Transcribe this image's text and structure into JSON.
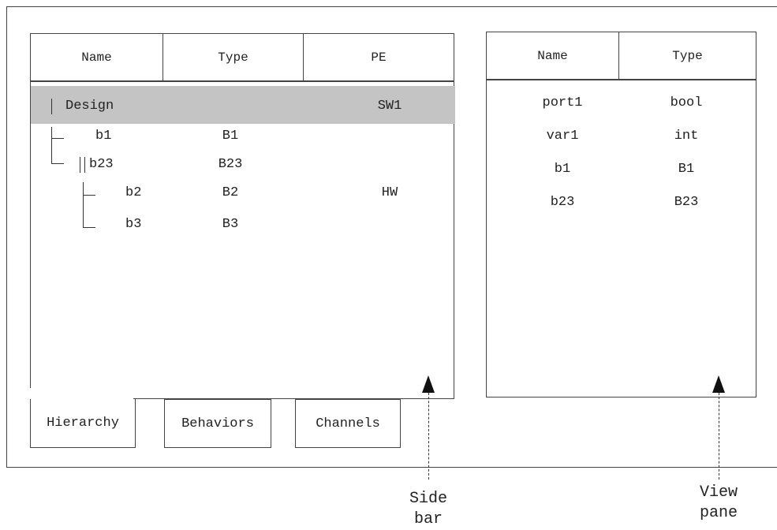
{
  "sidebar": {
    "headers": [
      "Name",
      "Type",
      "PE"
    ],
    "rows": [
      {
        "name": "Design",
        "type": "",
        "pe": "SW1",
        "selected": true
      },
      {
        "name": "b1",
        "type": "B1",
        "pe": ""
      },
      {
        "name": "b23",
        "type": "B23",
        "pe": ""
      },
      {
        "name": "b2",
        "type": "B2",
        "pe": "HW"
      },
      {
        "name": "b3",
        "type": "B3",
        "pe": ""
      }
    ],
    "tabs": [
      "Hierarchy",
      "Behaviors",
      "Channels"
    ],
    "active_tab": "Hierarchy",
    "highlight_color": "#c4c4c4"
  },
  "view_pane": {
    "headers": [
      "Name",
      "Type"
    ],
    "rows": [
      {
        "name": "port1",
        "type": "bool"
      },
      {
        "name": "var1",
        "type": "int"
      },
      {
        "name": "b1",
        "type": "B1"
      },
      {
        "name": "b23",
        "type": "B23"
      }
    ]
  },
  "callouts": {
    "side_bar": [
      "Side",
      "bar"
    ],
    "view_pane": [
      "View",
      "pane"
    ]
  }
}
